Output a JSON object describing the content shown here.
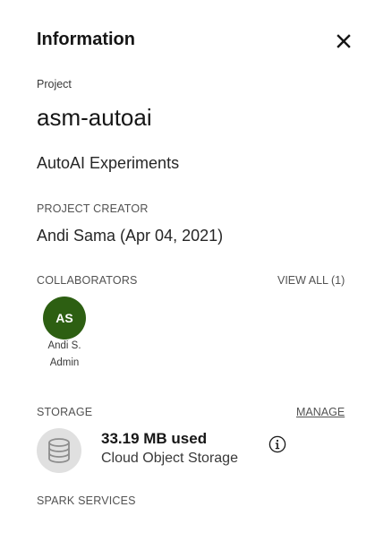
{
  "panel": {
    "title": "Information",
    "close_icon": "close-icon"
  },
  "project": {
    "label": "Project",
    "name": "asm-autoai",
    "description": "AutoAI Experiments"
  },
  "creator": {
    "label": "PROJECT CREATOR",
    "value": "Andi Sama (Apr 04, 2021)"
  },
  "collaborators": {
    "label": "COLLABORATORS",
    "view_all": "VIEW ALL (1)",
    "items": [
      {
        "initials": "AS",
        "name": "Andi S.",
        "role": "Admin",
        "avatar_color": "#2d5f12"
      }
    ]
  },
  "storage": {
    "label": "STORAGE",
    "manage": "MANAGE",
    "icon": "database-icon",
    "used": "33.19 MB used",
    "type": "Cloud Object Storage",
    "info_icon": "info-icon"
  },
  "spark": {
    "label": "SPARK SERVICES"
  }
}
